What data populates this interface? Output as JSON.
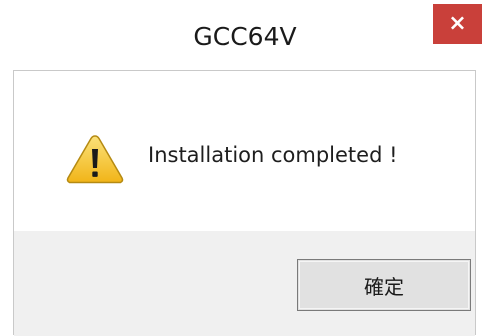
{
  "window": {
    "title": "GCC64V",
    "close_symbol": "×",
    "close_color": "#c9403a"
  },
  "dialog": {
    "icon": "warning-icon",
    "message": "Installation completed !",
    "ok_label": "確定"
  }
}
